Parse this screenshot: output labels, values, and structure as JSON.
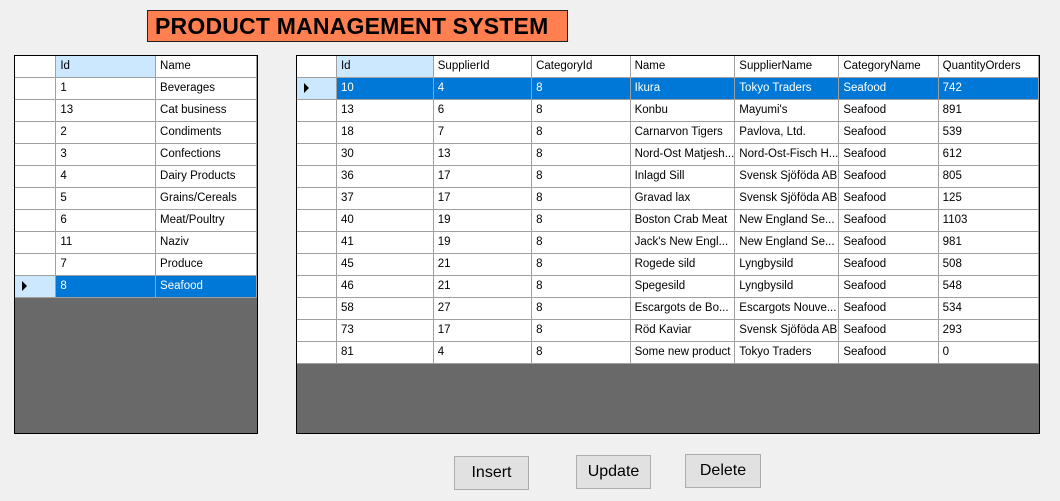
{
  "title": "PRODUCT MANAGEMENT SYSTEM",
  "colors": {
    "title_bg": "#ff7f50",
    "selection": "#0078d7",
    "grid_bg": "#696969",
    "header_sorted": "#cce8ff"
  },
  "categories_grid": {
    "columns": [
      "Id",
      "Name"
    ],
    "selected_index": 9,
    "rows": [
      [
        "1",
        "Beverages"
      ],
      [
        "13",
        "Cat business"
      ],
      [
        "2",
        "Condiments"
      ],
      [
        "3",
        "Confections"
      ],
      [
        "4",
        "Dairy Products"
      ],
      [
        "5",
        "Grains/Cereals"
      ],
      [
        "6",
        "Meat/Poultry"
      ],
      [
        "11",
        "Naziv"
      ],
      [
        "7",
        "Produce"
      ],
      [
        "8",
        "Seafood"
      ]
    ]
  },
  "products_grid": {
    "columns": [
      "Id",
      "SupplierId",
      "CategoryId",
      "Name",
      "SupplierName",
      "CategoryName",
      "QuantityOrders"
    ],
    "selected_index": 0,
    "rows": [
      [
        "10",
        "4",
        "8",
        "Ikura",
        "Tokyo Traders",
        "Seafood",
        "742"
      ],
      [
        "13",
        "6",
        "8",
        "Konbu",
        "Mayumi's",
        "Seafood",
        "891"
      ],
      [
        "18",
        "7",
        "8",
        "Carnarvon Tigers",
        "Pavlova, Ltd.",
        "Seafood",
        "539"
      ],
      [
        "30",
        "13",
        "8",
        "Nord-Ost Matjesh...",
        "Nord-Ost-Fisch H...",
        "Seafood",
        "612"
      ],
      [
        "36",
        "17",
        "8",
        "Inlagd Sill",
        "Svensk Sjöföda AB",
        "Seafood",
        "805"
      ],
      [
        "37",
        "17",
        "8",
        "Gravad lax",
        "Svensk Sjöföda AB",
        "Seafood",
        "125"
      ],
      [
        "40",
        "19",
        "8",
        "Boston Crab Meat",
        "New England Se...",
        "Seafood",
        "1103"
      ],
      [
        "41",
        "19",
        "8",
        "Jack's New Engl...",
        "New England Se...",
        "Seafood",
        "981"
      ],
      [
        "45",
        "21",
        "8",
        "Rogede sild",
        "Lyngbysild",
        "Seafood",
        "508"
      ],
      [
        "46",
        "21",
        "8",
        "Spegesild",
        "Lyngbysild",
        "Seafood",
        "548"
      ],
      [
        "58",
        "27",
        "8",
        "Escargots de Bo...",
        "Escargots Nouve...",
        "Seafood",
        "534"
      ],
      [
        "73",
        "17",
        "8",
        "Röd Kaviar",
        "Svensk Sjöföda AB",
        "Seafood",
        "293"
      ],
      [
        "81",
        "4",
        "8",
        "Some new product",
        "Tokyo Traders",
        "Seafood",
        "0"
      ]
    ]
  },
  "buttons": {
    "insert": "Insert",
    "update": "Update",
    "delete": "Delete"
  }
}
